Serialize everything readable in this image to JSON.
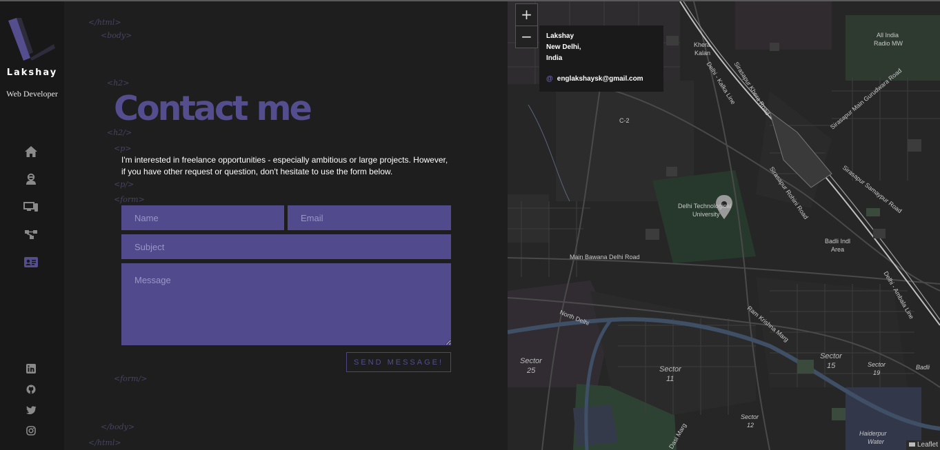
{
  "sidebar": {
    "brand_name": "Lakshay",
    "brand_subtitle": "Web Developer",
    "nav": [
      {
        "name": "home",
        "icon": "home-icon"
      },
      {
        "name": "about",
        "icon": "user-icon"
      },
      {
        "name": "skills",
        "icon": "devices-icon"
      },
      {
        "name": "work",
        "icon": "project-diagram-icon"
      },
      {
        "name": "contact",
        "icon": "contact-card-icon",
        "active": true
      }
    ],
    "social": [
      "linkedin-icon",
      "github-icon",
      "twitter-icon",
      "instagram-icon"
    ]
  },
  "tags": {
    "html_close": "</html>",
    "body_open": "<body>",
    "h2_open": "<h2>",
    "h2_close": "<h2/>",
    "p_open": "<p>",
    "p_close": "<p/>",
    "form_open": "<form>",
    "form_close": "<form/>",
    "body_close": "</body>",
    "html_close_bottom": "</html>"
  },
  "contact": {
    "heading": "Contact me",
    "intro": "I'm interested in freelance opportunities - especially ambitious or large projects. However, if you have other request or question, don't hesitate to use the form below.",
    "form": {
      "name_placeholder": "Name",
      "email_placeholder": "Email",
      "subject_placeholder": "Subject",
      "message_placeholder": "Message",
      "send_label": "SEND MESSAGE!"
    }
  },
  "map": {
    "zoom_in": "+",
    "zoom_out": "−",
    "info": {
      "name": "Lakshay",
      "city": "New Delhi,",
      "country": "India",
      "email_symbol": "@",
      "email": "englakshaysk@gmail.com"
    },
    "labels": {
      "khera_kalan_1": "Khera",
      "khera_kalan_2": "Kalan",
      "all_india_radio_1": "All India",
      "all_india_radio_2": "Radio MW",
      "sirasapur_khera": "Sirasapur Khera Road",
      "delhi_kalka": "Delhi - Kalka Line",
      "gurudwara": "Sirasapur Main Gurudwara Road",
      "c2": "C-2",
      "rohini": "Sirasapur Rohini Road",
      "samaypur": "Sirasapur Samaypur Road",
      "dtu_1": "Delhi Technological",
      "dtu_2": "University",
      "main_bawana": "Main Bawana Delhi Road",
      "badli_1": "Badli Indl",
      "badli_2": "Area",
      "north_delhi": "North Delhi",
      "ram_krishna": "Ram Krishna Marg",
      "delhi_ambala": "Delhi - Ambala Line",
      "sector_25_1": "Sector",
      "sector_25_2": "25",
      "sector_11_1": "Sector",
      "sector_11_2": "11",
      "sector_15_1": "Sector",
      "sector_15_2": "15",
      "sector_19_1": "Sector",
      "sector_19_2": "19",
      "badli": "Badli",
      "sector_12_1": "Sector",
      "sector_12_2": "12",
      "dasi_marg": "Dasi Marg",
      "haiderpur_1": "Haiderpur",
      "haiderpur_2": "Water"
    },
    "attribution": "Leaflet"
  },
  "colors": {
    "accent": "#544e8f",
    "field_bg": "#514a8c",
    "page_bg": "#1e1e1e",
    "sidebar_bg": "#181818"
  }
}
